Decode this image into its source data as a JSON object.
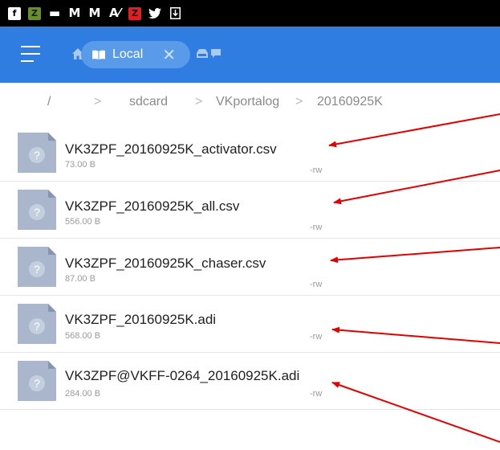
{
  "status_bar": {
    "icons": [
      "facebook-icon",
      "z-app-icon",
      "image-icon",
      "gmail-icon",
      "gmail-icon",
      "font-icon",
      "z-app-icon",
      "twitter-icon",
      "download-icon"
    ],
    "glyphs": [
      "f",
      "Z",
      "▬",
      "M",
      "M",
      "A⁄",
      "Z",
      "🐦",
      "⤓"
    ]
  },
  "app_bar": {
    "background": "#2f7de1",
    "chip_label": "Local",
    "close_glyph": "✕"
  },
  "breadcrumb": {
    "root": "/",
    "sep": ">",
    "items": [
      "sdcard",
      "VKportalog",
      "20160925K"
    ]
  },
  "files": [
    {
      "name": "VK3ZPF_20160925K_activator.csv",
      "size": "73.00 B",
      "perm": "-rw"
    },
    {
      "name": "VK3ZPF_20160925K_all.csv",
      "size": "556.00 B",
      "perm": "-rw"
    },
    {
      "name": "VK3ZPF_20160925K_chaser.csv",
      "size": "87.00 B",
      "perm": "-rw"
    },
    {
      "name": "VK3ZPF_20160925K.adi",
      "size": "568.00 B",
      "perm": "-rw"
    },
    {
      "name": "VK3ZPF@VKFF-0264_20160925K.adi",
      "size": "284.00 B",
      "perm": "-rw"
    }
  ],
  "annotation_color": "#e00000"
}
